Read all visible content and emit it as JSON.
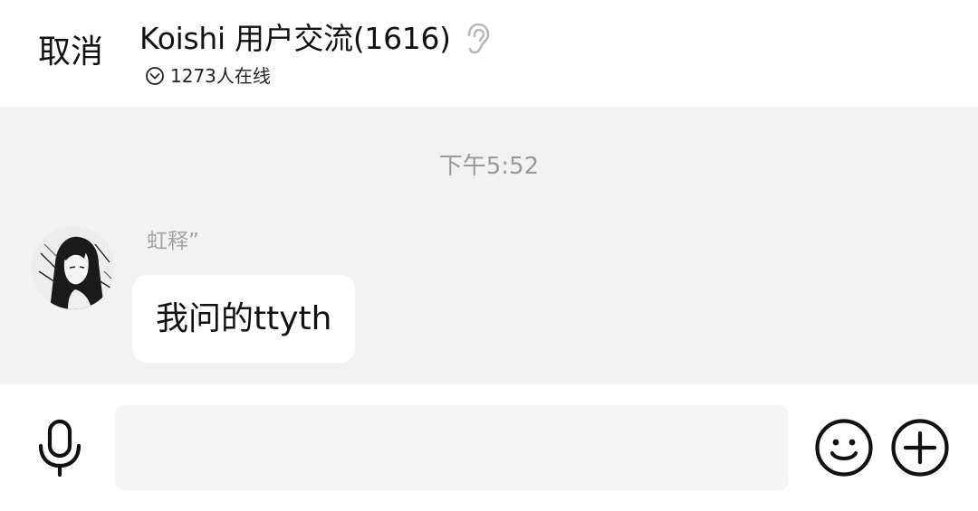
{
  "header": {
    "cancel_label": "取消",
    "title": "Koishi 用户交流(1616)",
    "online_text": "1273人在线",
    "icons": {
      "listen": "ear-icon",
      "online": "chevron-down-circle-icon"
    }
  },
  "chat": {
    "timestamp": "下午5:52",
    "messages": [
      {
        "sender": "虹释”",
        "text": "我问的ttyth",
        "avatar": "anime-girl-avatar"
      }
    ]
  },
  "input_bar": {
    "placeholder": "",
    "icons": {
      "voice": "microphone-icon",
      "emoji": "smiley-icon",
      "more": "plus-circle-icon"
    }
  },
  "colors": {
    "chat_background": "#f2f2f3",
    "bubble": "#ffffff",
    "timestamp": "#9a9a9a",
    "sender": "#a3a3a3"
  }
}
